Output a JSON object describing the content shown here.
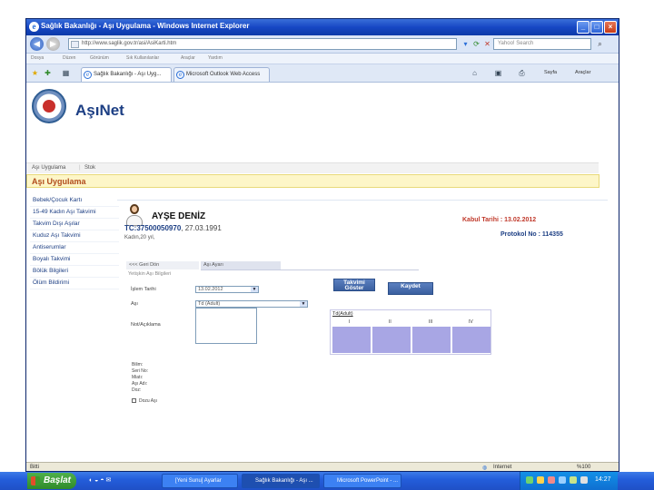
{
  "browser": {
    "title": "Sağlık Bakanlığı - Aşı Uygulama - Windows Internet Explorer",
    "address": "http://www.saglik.gov.tr/asi/AsiKarti.htm",
    "search_placeholder": "Yahoo! Search",
    "menu": [
      "Dosya",
      "Düzen",
      "Görünüm",
      "Sık Kullanılanlar",
      "Araçlar",
      "Yardım"
    ],
    "tabs": [
      {
        "label": "Sağlık Bakanlığı - Aşı Uyg...",
        "active": true
      },
      {
        "label": "Microsoft Outlook Web Access",
        "active": false
      }
    ],
    "toolbar_right": [
      "Sayfa",
      "Araçlar"
    ],
    "status_left": "Bitti",
    "status_zone": "Internet",
    "zoom": "%100"
  },
  "header": {
    "brand": "AşıNet"
  },
  "page_nav": [
    "Aşı Uygulama",
    "Stok"
  ],
  "section_title": "Aşı Uygulama",
  "sidebar": {
    "items": [
      "Bebek/Çocuk Kartı",
      "15-49 Kadın Aşı Takvimi",
      "Takvim Dışı Aşılar",
      "Kuduz Aşı Takvimi",
      "Antiserumlar",
      "Boyalı Takvimi",
      "Bölük Bilgileri",
      "Ölüm Bildirimi"
    ]
  },
  "patient": {
    "name": "AYŞE DENİZ",
    "tc": "TC:37500050970",
    "dob": ", 27.03.1991",
    "info": "Kadın,20 yıl,",
    "kabul": "Kabul Tarihi : 13.02.2012",
    "protokol": "Protokol No : 114355"
  },
  "subtabs": [
    "<<< Geri Dön",
    "Aşı Ayarı"
  ],
  "sublabel": "Yetişkin Aşı Bilgileri",
  "form": {
    "islem_label": "İşlem Tarihi",
    "islem_value": "13.02.2012",
    "asi_label": "Aşı",
    "asi_value": "Td (Adult)",
    "note_label": "Not/Açıklama",
    "btn_takvim": "Takvimi Göster",
    "btn_kaydet": "Kaydet"
  },
  "schedule": {
    "caption": "Td(Adult)",
    "columns": [
      "I",
      "II",
      "III",
      "IV"
    ]
  },
  "details": [
    "Bilim:",
    "Seri No:",
    "Miatı:",
    "Aşı Adı:",
    "Doz:"
  ],
  "dozaj_label": "Dozu Aşı",
  "taskbar": {
    "start": "Başlat",
    "tasks": [
      "[Yeni Sunu] Ayarlar",
      "Sağlık Bakanlığı - Aşı ...",
      "Microsoft PowerPoint - ..."
    ],
    "clock": "14:27"
  }
}
